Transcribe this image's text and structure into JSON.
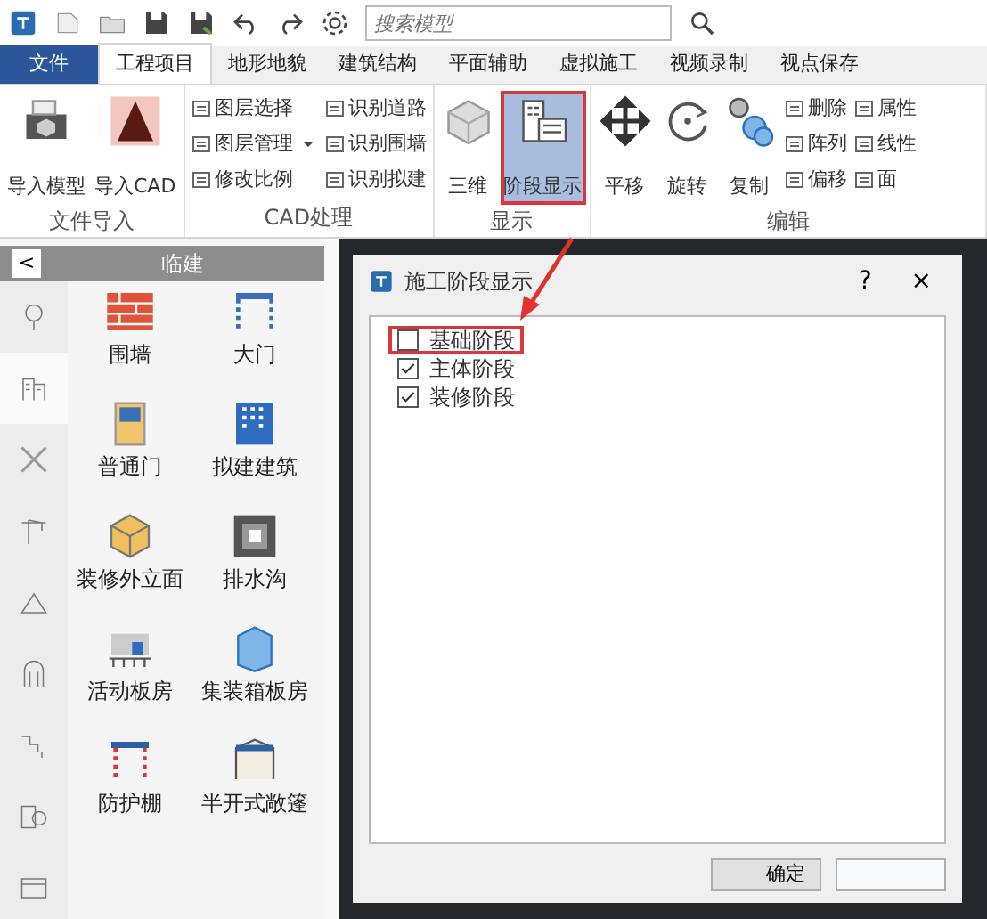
{
  "quick_toolbar": {
    "search": {
      "placeholder": "搜索模型"
    }
  },
  "tabs": [
    {
      "label": "文件",
      "kind": "file",
      "selected": false
    },
    {
      "label": "工程项目",
      "kind": "tab",
      "selected": true
    },
    {
      "label": "地形地貌",
      "kind": "tab",
      "selected": false
    },
    {
      "label": "建筑结构",
      "kind": "tab",
      "selected": false
    },
    {
      "label": "平面辅助",
      "kind": "tab",
      "selected": false
    },
    {
      "label": "虚拟施工",
      "kind": "tab",
      "selected": false
    },
    {
      "label": "视频录制",
      "kind": "tab",
      "selected": false
    },
    {
      "label": "视点保存",
      "kind": "tab",
      "selected": false
    }
  ],
  "ribbon_groups": [
    {
      "label": "文件导入",
      "items": [
        {
          "label": "导入模型",
          "kind": "large",
          "selected": false
        },
        {
          "label": "导入CAD",
          "kind": "large",
          "selected": false
        }
      ]
    },
    {
      "label": "CAD处理",
      "items": [
        {
          "label": "图层选择",
          "kind": "small",
          "selected": false
        },
        {
          "label": "图层管理",
          "kind": "dropdown",
          "selected": false
        },
        {
          "label": "修改比例",
          "kind": "small",
          "selected": false
        },
        {
          "label": "识别道路",
          "kind": "small",
          "selected": false
        },
        {
          "label": "识别围墙",
          "kind": "small",
          "selected": false
        },
        {
          "label": "识别拟建",
          "kind": "small",
          "selected": false
        }
      ]
    },
    {
      "label": "显示",
      "items": [
        {
          "label": "三维",
          "kind": "large",
          "selected": false
        },
        {
          "label": "阶段显示",
          "kind": "large",
          "selected": true
        }
      ]
    },
    {
      "label": "编辑",
      "items": [
        {
          "label": "平移",
          "kind": "large",
          "selected": false
        },
        {
          "label": "旋转",
          "kind": "large",
          "selected": false
        },
        {
          "label": "复制",
          "kind": "large",
          "selected": false
        },
        {
          "label": "删除",
          "kind": "small",
          "selected": false
        },
        {
          "label": "阵列",
          "kind": "small",
          "selected": false
        },
        {
          "label": "偏移",
          "kind": "small",
          "selected": false
        },
        {
          "label": "属性",
          "kind": "small",
          "selected": false
        },
        {
          "label": "线性",
          "kind": "small",
          "selected": false
        },
        {
          "label": "面",
          "kind": "small",
          "selected": false
        }
      ]
    }
  ],
  "side_panel": {
    "back": "<",
    "title": "临建",
    "rail": [
      {
        "selected": false
      },
      {
        "selected": true
      },
      {
        "selected": false
      },
      {
        "selected": false
      },
      {
        "selected": false
      },
      {
        "selected": false
      },
      {
        "selected": false
      },
      {
        "selected": false
      },
      {
        "selected": false
      }
    ],
    "items": [
      {
        "label": "围墙"
      },
      {
        "label": "大门"
      },
      {
        "label": "普通门"
      },
      {
        "label": "拟建建筑"
      },
      {
        "label": "装修外立面"
      },
      {
        "label": "排水沟"
      },
      {
        "label": "活动板房"
      },
      {
        "label": "集装箱板房"
      },
      {
        "label": "防护棚"
      },
      {
        "label": "半开式敞篷"
      }
    ]
  },
  "dialog": {
    "title": "施工阶段显示",
    "help": "?",
    "close": "×",
    "stages": [
      {
        "label": "基础阶段",
        "checked": false,
        "highlighted": true
      },
      {
        "label": "主体阶段",
        "checked": true,
        "highlighted": false
      },
      {
        "label": "装修阶段",
        "checked": true,
        "highlighted": false
      }
    ],
    "buttons": [
      {
        "kind": "ok",
        "label": "确定"
      },
      {
        "kind": "blank"
      }
    ]
  }
}
